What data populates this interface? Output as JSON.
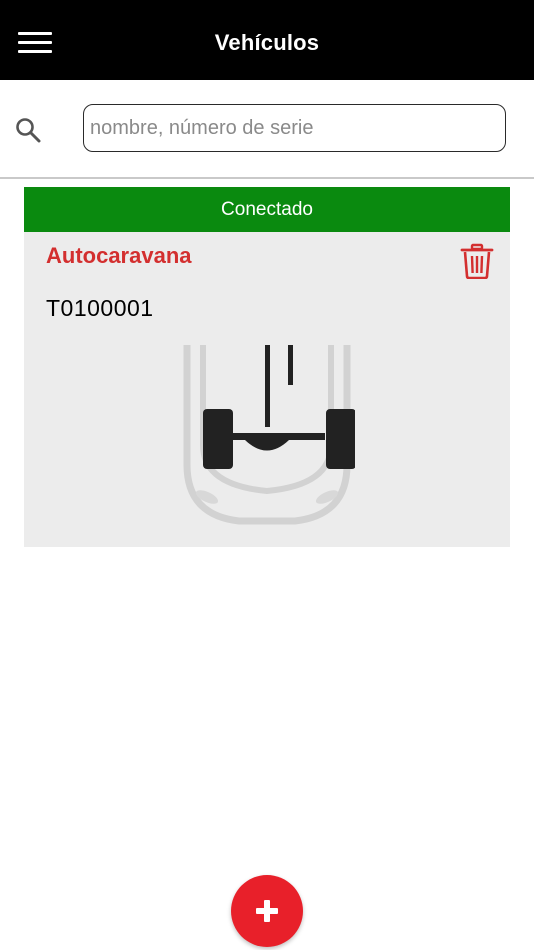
{
  "appbar": {
    "title": "Vehículos",
    "menu_icon": "hamburger-menu-icon"
  },
  "search": {
    "icon": "search-icon",
    "placeholder": "nombre, número de serie",
    "value": ""
  },
  "vehicles": [
    {
      "status": "Conectado",
      "status_color": "#0a8a0f",
      "name": "Autocaravana",
      "name_color": "#d32f2f",
      "serial": "T0100001",
      "delete_icon": "trash-icon",
      "image": "vehicle-axle-diagram"
    }
  ],
  "fab": {
    "icon": "plus-icon",
    "color": "#e8202a"
  }
}
